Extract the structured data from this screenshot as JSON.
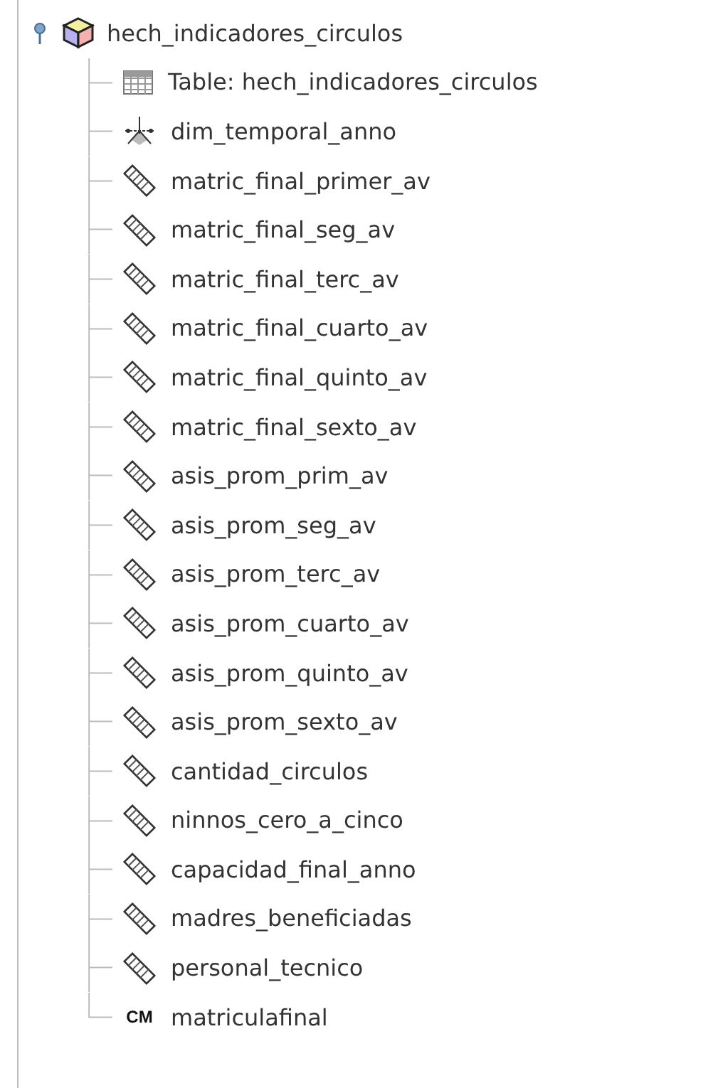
{
  "tree": {
    "label": "hech_indicadores_circulos",
    "expanded": true,
    "children": [
      {
        "kind": "table",
        "label": "Table: hech_indicadores_circulos"
      },
      {
        "kind": "dimension",
        "label": "dim_temporal_anno"
      },
      {
        "kind": "measure",
        "label": "matric_final_primer_av"
      },
      {
        "kind": "measure",
        "label": "matric_final_seg_av"
      },
      {
        "kind": "measure",
        "label": "matric_final_terc_av"
      },
      {
        "kind": "measure",
        "label": "matric_final_cuarto_av"
      },
      {
        "kind": "measure",
        "label": "matric_final_quinto_av"
      },
      {
        "kind": "measure",
        "label": "matric_final_sexto_av"
      },
      {
        "kind": "measure",
        "label": "asis_prom_prim_av"
      },
      {
        "kind": "measure",
        "label": "asis_prom_seg_av"
      },
      {
        "kind": "measure",
        "label": "asis_prom_terc_av"
      },
      {
        "kind": "measure",
        "label": "asis_prom_cuarto_av"
      },
      {
        "kind": "measure",
        "label": "asis_prom_quinto_av"
      },
      {
        "kind": "measure",
        "label": "asis_prom_sexto_av"
      },
      {
        "kind": "measure",
        "label": "cantidad_circulos"
      },
      {
        "kind": "measure",
        "label": "ninnos_cero_a_cinco"
      },
      {
        "kind": "measure",
        "label": "capacidad_final_anno"
      },
      {
        "kind": "measure",
        "label": "madres_beneficiadas"
      },
      {
        "kind": "measure",
        "label": "personal_tecnico"
      },
      {
        "kind": "calculated",
        "badge": "CM",
        "label": "matriculafinal"
      }
    ]
  }
}
